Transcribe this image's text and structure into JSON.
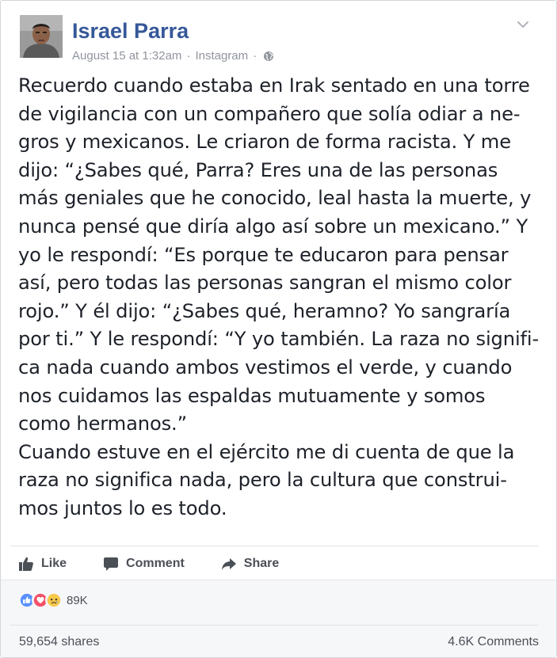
{
  "post": {
    "author": "Israel Parra",
    "timestamp": "August 15 at 1:32am",
    "separator": "·",
    "source": "Instagram",
    "privacy_icon": "globe-icon",
    "menu_icon": "chevron-down-icon",
    "body_lines": [
      "Recuerdo cuando estaba en Irak sentado en una torre",
      "de vigilancia con un compañero que solía odiar a ne-",
      "gros y mexicanos. Le criaron de forma racista. Y me",
      "dijo: “¿Sabes qué, Parra? Eres una de las personas",
      "más geniales que he conocido, leal hasta la muerte, y",
      "nunca pensé que diría algo así sobre un mexicano.” Y",
      "yo le respondí: “Es porque te educaron para pensar",
      "así, pero todas las personas sangran el mismo color",
      "rojo.” Y él dijo: “¿Sabes qué, heramno? Yo sangraría",
      "por ti.” Y le respondí: “Y yo también. La raza no signifi-",
      "ca nada cuando ambos vestimos el verde, y cuando",
      "nos cuidamos las espaldas mutuamente y somos",
      "como hermanos.”",
      "Cuando estuve en el ejército me di cuenta de que la",
      "raza no significa nada, pero la cultura que construi-",
      "mos juntos lo es todo."
    ]
  },
  "actions": {
    "like_label": "Like",
    "comment_label": "Comment",
    "share_label": "Share"
  },
  "reactions": {
    "icons": [
      "like-icon",
      "love-icon",
      "sad-icon"
    ],
    "count": "89K"
  },
  "footer": {
    "shares": "59,654 shares",
    "comments": "4.6K Comments"
  },
  "colors": {
    "author_link": "#365899",
    "meta_text": "#90949c",
    "body_text": "#1d2129",
    "action_text": "#4b4f56",
    "like_blue": "#5890ff",
    "love_red": "#f25268",
    "sad_yellow": "#f7c94b"
  }
}
